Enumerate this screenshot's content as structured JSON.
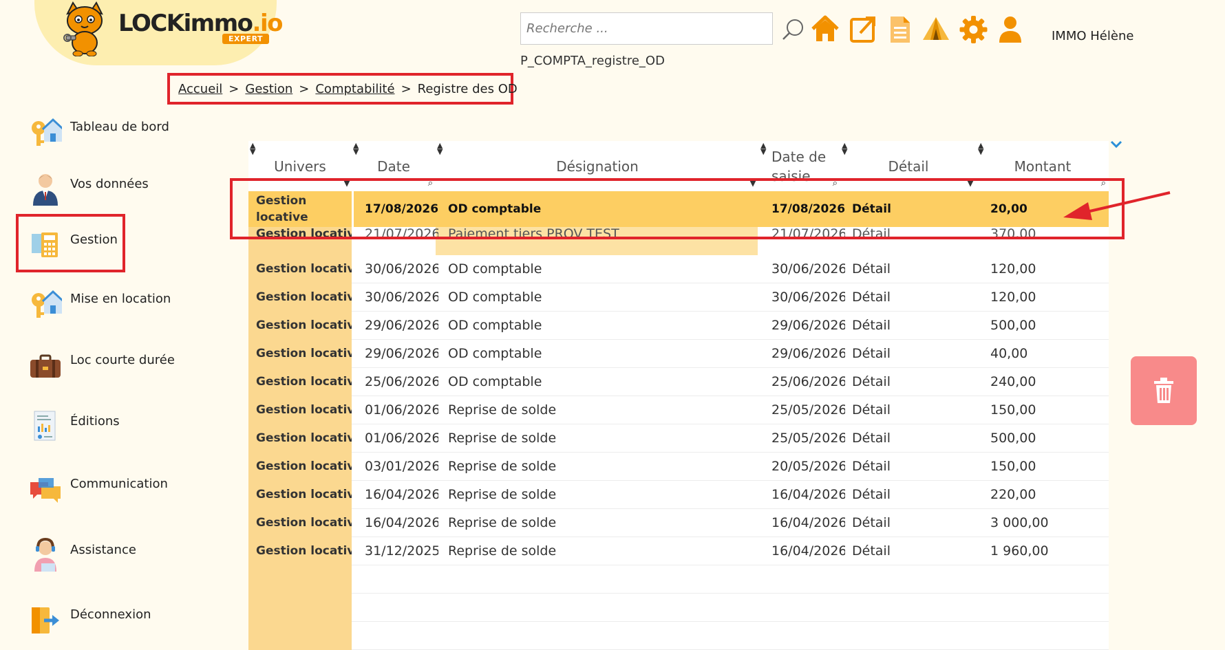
{
  "brand": {
    "name_main": "LOCKimmo",
    "name_suffix": ".io",
    "badge": "EXPERT"
  },
  "search": {
    "placeholder": "Recherche ..."
  },
  "page_code": "P_COMPTA_registre_OD",
  "header": {
    "icons": [
      "home-icon",
      "external-link-icon",
      "document-icon",
      "tent-icon",
      "gear-icon",
      "user-icon"
    ],
    "user_name": "IMMO Hélène"
  },
  "breadcrumb": {
    "items": [
      "Accueil",
      "Gestion",
      "Comptabilité"
    ],
    "current": "Registre des OD",
    "separator": ">"
  },
  "sidebar": {
    "items": [
      {
        "label": "Tableau de bord",
        "icon": "house-key-icon"
      },
      {
        "label": "Vos données",
        "icon": "person-icon"
      },
      {
        "label": "Gestion",
        "icon": "calculator-icon"
      },
      {
        "label": "Mise en location",
        "icon": "house-key-icon"
      },
      {
        "label": "Loc courte durée",
        "icon": "suitcase-icon"
      },
      {
        "label": "Éditions",
        "icon": "report-icon"
      },
      {
        "label": "Communication",
        "icon": "chat-bubbles-icon"
      },
      {
        "label": "Assistance",
        "icon": "support-agent-icon"
      },
      {
        "label": "Déconnexion",
        "icon": "logout-icon"
      }
    ]
  },
  "table": {
    "columns": [
      "Univers",
      "Date",
      "Désignation",
      "Date de saisie",
      "Détail",
      "Montant"
    ],
    "selected_row": {
      "univers": "Gestion locative",
      "date": "17/08/2026",
      "designation": "OD comptable",
      "date_saisie": "17/08/2026",
      "detail": "Détail",
      "montant": "20,00"
    },
    "partial_row": {
      "univers": "Gestion locative",
      "date": "21/07/2026",
      "designation": "Paiement tiers PROV TEST",
      "date_saisie": "21/07/2026",
      "detail": "Détail",
      "montant": "370,00"
    },
    "rows": [
      {
        "univers": "Gestion locative",
        "date": "30/06/2026",
        "designation": "OD comptable",
        "date_saisie": "30/06/2026",
        "detail": "Détail",
        "montant": "120,00"
      },
      {
        "univers": "Gestion locative",
        "date": "30/06/2026",
        "designation": "OD comptable",
        "date_saisie": "30/06/2026",
        "detail": "Détail",
        "montant": "120,00"
      },
      {
        "univers": "Gestion locative",
        "date": "29/06/2026",
        "designation": "OD comptable",
        "date_saisie": "29/06/2026",
        "detail": "Détail",
        "montant": "500,00"
      },
      {
        "univers": "Gestion locative",
        "date": "29/06/2026",
        "designation": "OD comptable",
        "date_saisie": "29/06/2026",
        "detail": "Détail",
        "montant": "40,00"
      },
      {
        "univers": "Gestion locative",
        "date": "25/06/2026",
        "designation": "OD comptable",
        "date_saisie": "25/06/2026",
        "detail": "Détail",
        "montant": "240,00"
      },
      {
        "univers": "Gestion locative",
        "date": "01/06/2026",
        "designation": "Reprise de solde",
        "date_saisie": "25/05/2026",
        "detail": "Détail",
        "montant": "150,00"
      },
      {
        "univers": "Gestion locative",
        "date": "01/06/2026",
        "designation": "Reprise de solde",
        "date_saisie": "25/05/2026",
        "detail": "Détail",
        "montant": "500,00"
      },
      {
        "univers": "Gestion locative",
        "date": "03/01/2026",
        "designation": "Reprise de solde",
        "date_saisie": "20/05/2026",
        "detail": "Détail",
        "montant": "150,00"
      },
      {
        "univers": "Gestion locative",
        "date": "16/04/2026",
        "designation": "Reprise de solde",
        "date_saisie": "16/04/2026",
        "detail": "Détail",
        "montant": "220,00"
      },
      {
        "univers": "Gestion locative",
        "date": "16/04/2026",
        "designation": "Reprise de solde",
        "date_saisie": "16/04/2026",
        "detail": "Détail",
        "montant": "3 000,00"
      },
      {
        "univers": "Gestion locative",
        "date": "31/12/2025",
        "designation": "Reprise de solde",
        "date_saisie": "16/04/2026",
        "detail": "Détail",
        "montant": "1 960,00"
      }
    ]
  },
  "actions": {
    "delete_icon": "trash-icon"
  },
  "colors": {
    "accent": "#f29100",
    "highlight_red": "#e0242b",
    "selected_row": "#fdce62",
    "univers_col": "#fbd890",
    "delete_button": "#f88a8a",
    "background": "#fffbef"
  }
}
